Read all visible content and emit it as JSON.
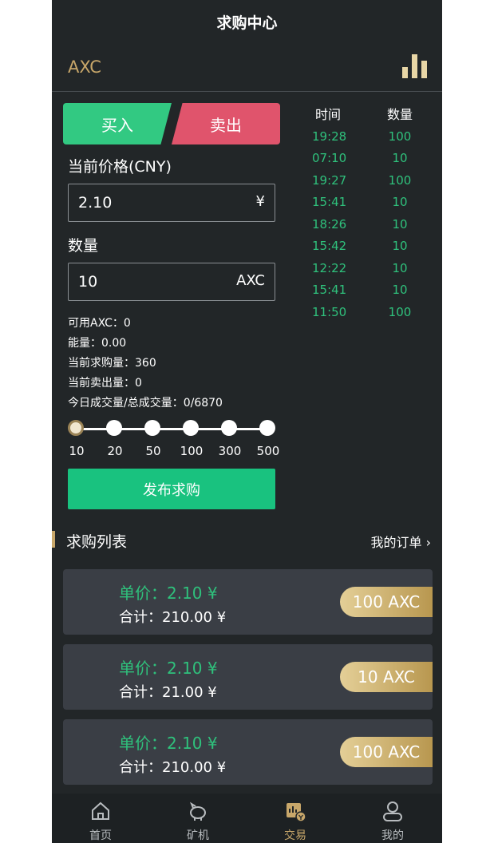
{
  "header": {
    "title": "求购中心",
    "coin": "AXC"
  },
  "tabs": {
    "buy": "买入",
    "sell": "卖出"
  },
  "form": {
    "price_label": "当前价格(CNY)",
    "price_value": "2.10",
    "price_unit": "¥",
    "qty_label": "数量",
    "qty_value": "10",
    "qty_unit": "AXC"
  },
  "info": [
    "可用AXC：0",
    "能量：0.00",
    "当前求购量：360",
    "当前卖出量：0",
    "今日成交量/总成交量：0/6870"
  ],
  "trades": {
    "col_time": "时间",
    "col_qty": "数量",
    "rows": [
      {
        "time": "19:28",
        "qty": "100"
      },
      {
        "time": "07:10",
        "qty": "10"
      },
      {
        "time": "19:27",
        "qty": "100"
      },
      {
        "time": "15:41",
        "qty": "10"
      },
      {
        "time": "18:26",
        "qty": "10"
      },
      {
        "time": "15:42",
        "qty": "10"
      },
      {
        "time": "12:22",
        "qty": "10"
      },
      {
        "time": "15:41",
        "qty": "10"
      },
      {
        "time": "11:50",
        "qty": "100"
      }
    ]
  },
  "slider": {
    "options": [
      "10",
      "20",
      "50",
      "100",
      "300",
      "500"
    ],
    "selected": "10"
  },
  "publish_label": "发布求购",
  "list": {
    "title": "求购列表",
    "my_orders": "我的订单 ›",
    "cards": [
      {
        "price": "单价：2.10 ¥",
        "total": "合计：210.00 ¥",
        "badge": "100 AXC"
      },
      {
        "price": "单价：2.10 ¥",
        "total": "合计：21.00 ¥",
        "badge": "10 AXC"
      },
      {
        "price": "单价：2.10 ¥",
        "total": "合计：210.00 ¥",
        "badge": "100 AXC"
      }
    ]
  },
  "nav": {
    "home": "首页",
    "miner": "矿机",
    "trade": "交易",
    "mine": "我的",
    "active": "trade"
  },
  "colors": {
    "accent": "#c8a76a",
    "buy": "#32c982",
    "sell": "#e0546c",
    "bg": "#222628"
  }
}
